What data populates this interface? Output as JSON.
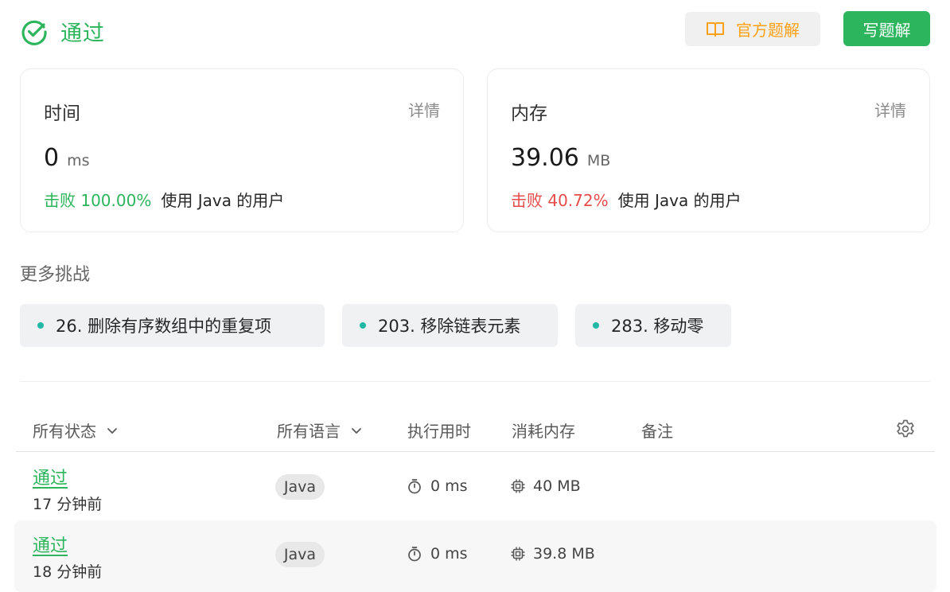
{
  "header": {
    "status": "通过",
    "official_solution": "官方题解",
    "write_solution": "写题解"
  },
  "time_card": {
    "title": "时间",
    "detail": "详情",
    "value": "0",
    "unit": "ms",
    "beat_prefix": "击败 100.00%",
    "beat_suffix": "使用 Java 的用户"
  },
  "memory_card": {
    "title": "内存",
    "detail": "详情",
    "value": "39.06",
    "unit": "MB",
    "beat_prefix": "击败 40.72%",
    "beat_suffix": "使用 Java 的用户"
  },
  "more": {
    "title": "更多挑战",
    "items": [
      "26. 删除有序数组中的重复项",
      "203. 移除链表元素",
      "283. 移动零"
    ]
  },
  "table": {
    "headers": {
      "status": "所有状态",
      "language": "所有语言",
      "runtime": "执行用时",
      "memory": "消耗内存",
      "note": "备注"
    },
    "rows": [
      {
        "status": "通过",
        "ago": "17 分钟前",
        "language": "Java",
        "runtime": "0 ms",
        "memory": "40 MB"
      },
      {
        "status": "通过",
        "ago": "18 分钟前",
        "language": "Java",
        "runtime": "0 ms",
        "memory": "39.8 MB"
      }
    ]
  },
  "colors": {
    "accent_green": "#2db55d",
    "accent_orange": "#ffa116",
    "beat_red": "#e84b4b",
    "chip_dot": "#21b8a6"
  },
  "icons": {
    "status": "check-circle-icon",
    "official": "book-icon",
    "chevron": "chevron-down-icon",
    "settings": "gear-icon",
    "runtime": "stopwatch-icon",
    "memory": "chip-icon"
  }
}
